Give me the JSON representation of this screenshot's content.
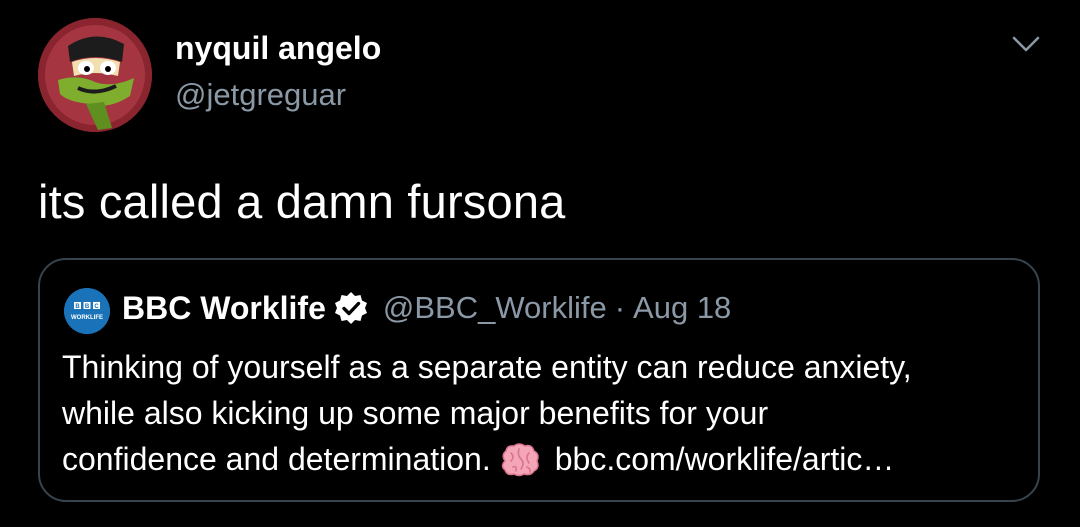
{
  "tweet": {
    "author": {
      "display_name": "nyquil angelo",
      "handle": "@jetgreguar"
    },
    "text": "its called a damn fursona",
    "menu_icon": "chevron-down-icon"
  },
  "quoted_tweet": {
    "author": {
      "display_name": "BBC Worklife",
      "handle": "@BBC_Worklife",
      "verified": true,
      "avatar_text_top": "BBC",
      "avatar_text_bottom": "WORKLIFE"
    },
    "separator": "·",
    "date": "Aug 18",
    "body_lines": [
      "Thinking of yourself as a separate entity can reduce anxiety,",
      "while also kicking up some major benefits for your",
      "confidence and determination."
    ],
    "emoji": "brain-emoji",
    "link_text": "bbc.com/worklife/artic…"
  },
  "colors": {
    "background": "#000000",
    "text": "#ffffff",
    "secondary_text": "#8b98a5",
    "card_border": "#38444d",
    "bbc_blue": "#1a73b8"
  }
}
